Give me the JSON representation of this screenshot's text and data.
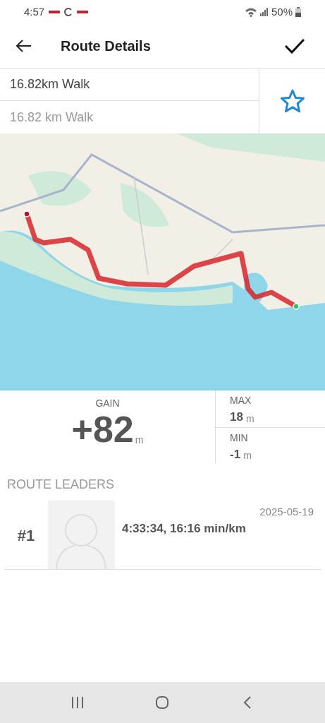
{
  "status_bar": {
    "time": "4:57",
    "battery": "50%"
  },
  "header": {
    "title": "Route Details"
  },
  "route": {
    "name": "16.82km Walk",
    "description_placeholder": "16.82 km Walk",
    "favorite": false
  },
  "elevation": {
    "gain": {
      "label": "GAIN",
      "value": "+82",
      "unit": "m"
    },
    "max": {
      "label": "MAX",
      "value": "18",
      "unit": "m"
    },
    "min": {
      "label": "MIN",
      "value": "-1",
      "unit": "m"
    }
  },
  "leaders": {
    "title": "ROUTE LEADERS",
    "rows": [
      {
        "rank": "#1",
        "result": "4:33:34, 16:16 min/km",
        "date": "2025-05-19"
      }
    ]
  }
}
